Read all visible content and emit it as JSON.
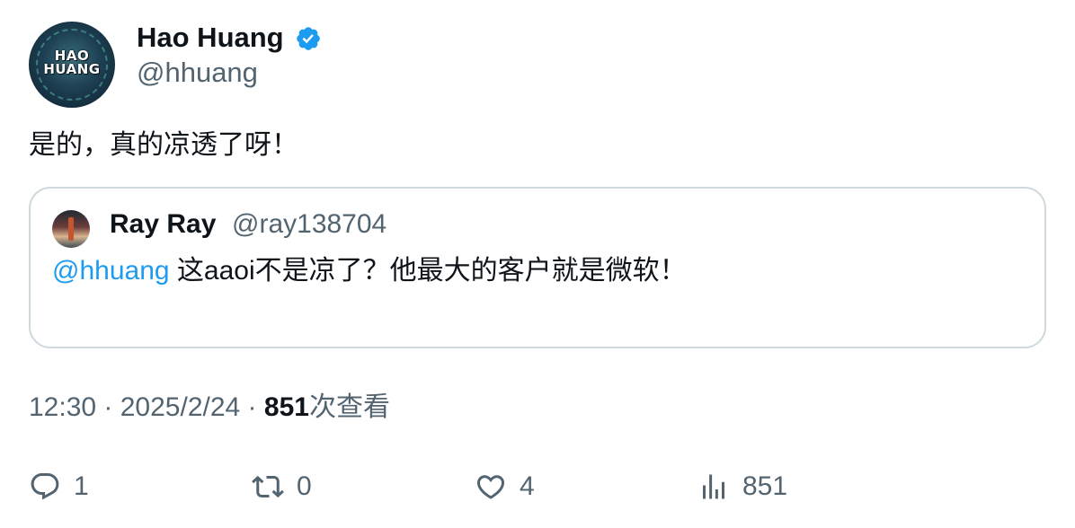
{
  "author": {
    "display_name": "Hao Huang",
    "handle": "@hhuang",
    "verified": true,
    "avatar_text_line1": "HAO",
    "avatar_text_line2": "HUANG"
  },
  "tweet": {
    "text": "是的，真的凉透了呀！"
  },
  "quoted_tweet": {
    "display_name": "Ray Ray",
    "handle": "@ray138704",
    "mention": "@hhuang",
    "text": " 这aaoi不是凉了？他最大的客户就是微软！"
  },
  "meta": {
    "time": "12:30",
    "separator": " · ",
    "date": "2025/2/24",
    "views_count": "851",
    "views_label": "次查看"
  },
  "actions": {
    "reply_count": "1",
    "retweet_count": "0",
    "like_count": "4",
    "views_count": "851"
  },
  "colors": {
    "accent": "#1d9bf0",
    "secondary_text": "#536471",
    "border": "#cfd9de"
  }
}
